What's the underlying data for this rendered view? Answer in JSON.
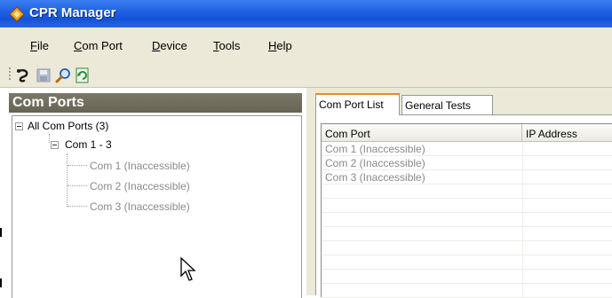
{
  "window": {
    "title": "CPR Manager"
  },
  "menu": [
    "File",
    "Com Port",
    "Device",
    "Tools",
    "Help"
  ],
  "toolbar": {
    "buttons": [
      "connect-icon",
      "save-icon",
      "search-icon",
      "refresh-icon"
    ]
  },
  "left_panel": {
    "header": "Com Ports",
    "tree": {
      "root": "All Com Ports (3)",
      "group": "Com 1 - 3",
      "items": [
        "Com 1 (Inaccessible)",
        "Com 2 (Inaccessible)",
        "Com 3 (Inaccessible)"
      ]
    }
  },
  "right_panel": {
    "tabs": [
      "Com Port List",
      "General Tests"
    ],
    "table": {
      "columns": [
        "Com Port",
        "IP Address"
      ],
      "rows": [
        [
          "Com 1 (Inaccessible)",
          ""
        ],
        [
          "Com 2 (Inaccessible)",
          ""
        ],
        [
          "Com 3 (Inaccessible)",
          ""
        ]
      ]
    }
  },
  "colors": {
    "titlebar": "#1f5fe0",
    "panel_header": "#6f6b5c",
    "disabled_text": "#8a8a8a",
    "chrome": "#ece9d8"
  }
}
